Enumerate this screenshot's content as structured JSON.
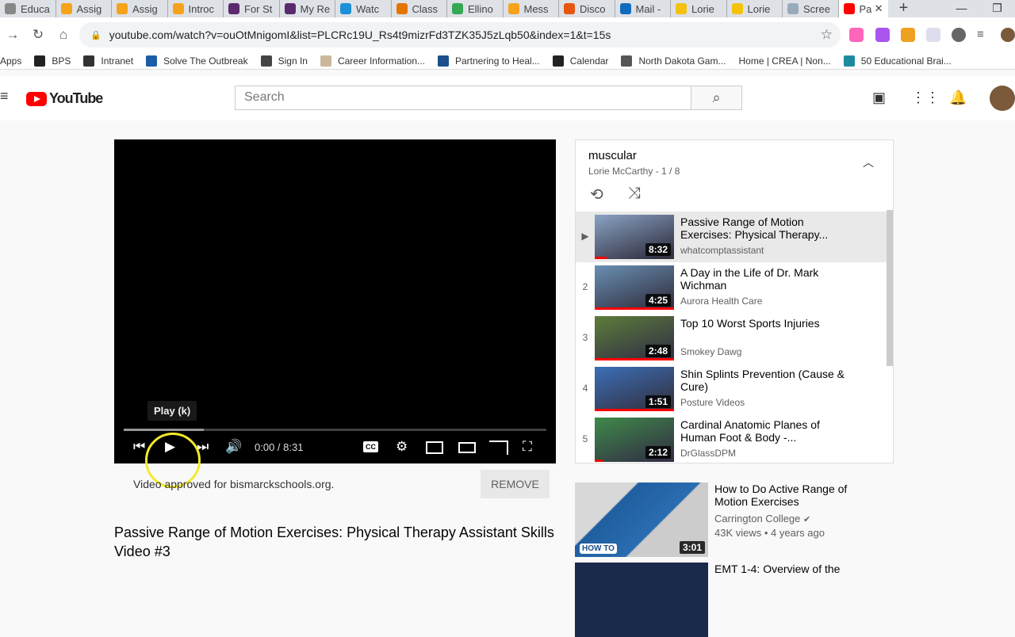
{
  "browser": {
    "tabs": [
      {
        "label": "Educa",
        "color": "#888"
      },
      {
        "label": "Assig",
        "color": "#f4a31a"
      },
      {
        "label": "Assig",
        "color": "#f4a31a"
      },
      {
        "label": "Introc",
        "color": "#f4a31a"
      },
      {
        "label": "For St",
        "color": "#5b2a6e"
      },
      {
        "label": "My Re",
        "color": "#5b2a6e"
      },
      {
        "label": "Watc",
        "color": "#1d8fd6"
      },
      {
        "label": "Class",
        "color": "#e37400"
      },
      {
        "label": "Ellino",
        "color": "#34a853"
      },
      {
        "label": "Mess",
        "color": "#f4a31a"
      },
      {
        "label": "Disco",
        "color": "#e8550f"
      },
      {
        "label": "Mail -",
        "color": "#0f6cbd"
      },
      {
        "label": "Lorie",
        "color": "#f4c20d"
      },
      {
        "label": "Lorie",
        "color": "#f4c20d"
      },
      {
        "label": "Scree",
        "color": "#9ab"
      }
    ],
    "active_tab": {
      "label": "Pa",
      "close": "✕",
      "color": "#f00"
    },
    "new_tab": "+",
    "url": "youtube.com/watch?v=ouOtMnigomI&list=PLCRc19U_Rs4t9mizrFd3TZK35J5zLqb50&index=1&t=15s",
    "bookmarks": [
      {
        "label": "Apps",
        "color": ""
      },
      {
        "label": "BPS",
        "color": "#222"
      },
      {
        "label": "Intranet",
        "color": "#333"
      },
      {
        "label": "Solve The Outbreak",
        "color": "#1b5ea6"
      },
      {
        "label": "Sign In",
        "color": "#444"
      },
      {
        "label": "Career Information...",
        "color": "#c9b89a"
      },
      {
        "label": "Partnering to Heal...",
        "color": "#1a4f8a"
      },
      {
        "label": "Calendar",
        "color": "#222"
      },
      {
        "label": "North Dakota Gam...",
        "color": "#555"
      },
      {
        "label": "Home | CREA | Non...",
        "color": ""
      },
      {
        "label": "50 Educational Brai...",
        "color": "#1e8aa0"
      }
    ]
  },
  "youtube": {
    "logo": "YouTube",
    "search_placeholder": "Search",
    "player": {
      "tooltip": "Play (k)",
      "time": "0:00 / 8:31",
      "buffered_fraction": 0.19,
      "cc": "CC"
    },
    "approved": "Video approved for bismarckschools.org.",
    "remove": "REMOVE",
    "title": "Passive Range of Motion Exercises: Physical Therapy Assistant Skills Video #3",
    "playlist": {
      "name": "muscular",
      "sub": "Lorie McCarthy - 1 / 8",
      "items": [
        {
          "index": "▶",
          "title": "Passive Range of Motion Exercises: Physical Therapy...",
          "channel": "whatcomptassistant",
          "duration": "8:32",
          "color": "#8aa3c4",
          "selected": true,
          "watched": 0.15
        },
        {
          "index": "2",
          "title": "A Day in the Life of Dr. Mark Wichman",
          "channel": "Aurora Health Care",
          "duration": "4:25",
          "color": "#6a8fb3",
          "watched": 1
        },
        {
          "index": "3",
          "title": "Top 10 Worst Sports Injuries",
          "channel": "Smokey Dawg",
          "duration": "2:48",
          "color": "#5d7d3a",
          "watched": 1
        },
        {
          "index": "4",
          "title": "Shin Splints Prevention (Cause & Cure)",
          "channel": "Posture Videos",
          "duration": "1:51",
          "color": "#3b6fb8",
          "watched": 1
        },
        {
          "index": "5",
          "title": "Cardinal Anatomic Planes of Human Foot & Body -...",
          "channel": "DrGlassDPM",
          "duration": "2:12",
          "color": "#3f8a4a",
          "watched": 0.1
        }
      ]
    },
    "recommended": [
      {
        "title": "How to Do Active Range of Motion Exercises",
        "channel": "Carrington College",
        "verified": "✔",
        "views": "43K views • 4 years ago",
        "duration": "3:01",
        "badge": "HOW TO"
      },
      {
        "title": "EMT 1-4: Overview of the"
      }
    ]
  }
}
